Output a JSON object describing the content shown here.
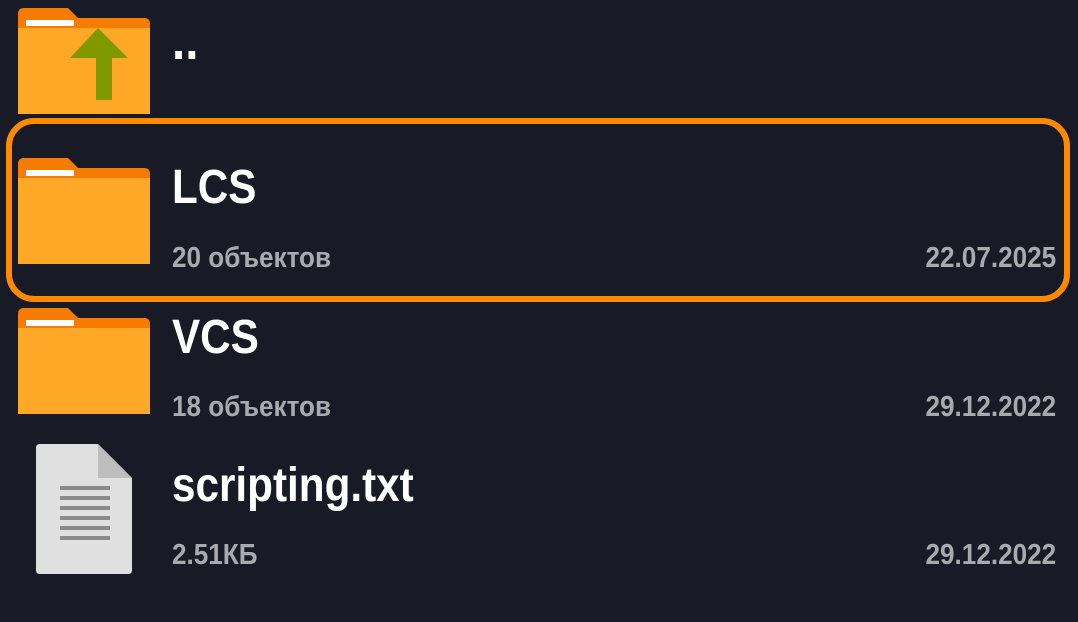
{
  "colors": {
    "background": "#181a25",
    "selection": "#ff8a00",
    "folder": "#ffa726",
    "folder_tab": "#f57c00",
    "up_arrow": "#7f9a00",
    "file_icon": "#e0e0e0",
    "primary_text": "#ffffff",
    "secondary_text": "#a9a9ae"
  },
  "entries": [
    {
      "name": "..",
      "icon": "folder-up-icon",
      "subtitle": "",
      "date": ""
    },
    {
      "name": "LCS",
      "icon": "folder-icon",
      "subtitle": "20 объектов",
      "date": "22.07.2025",
      "selected": true
    },
    {
      "name": "VCS",
      "icon": "folder-icon",
      "subtitle": "18 объектов",
      "date": "29.12.2022"
    },
    {
      "name": "scripting.txt",
      "icon": "text-file-icon",
      "subtitle": "2.51КБ",
      "date": "29.12.2022"
    }
  ]
}
